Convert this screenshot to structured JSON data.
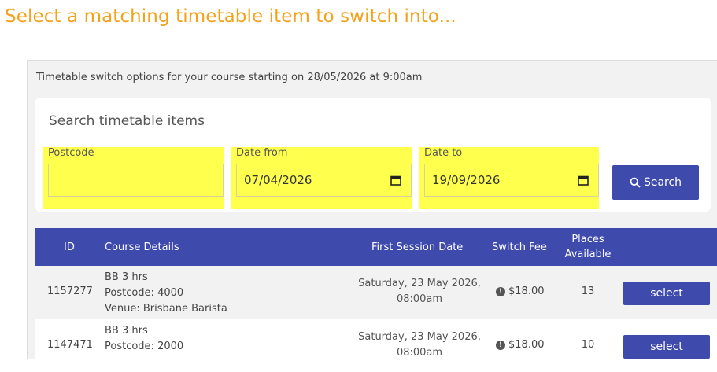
{
  "page": {
    "title": "Select a matching timetable item to switch into..."
  },
  "panel": {
    "intro": "Timetable switch options for your course starting on 28/05/2026 at 9:00am"
  },
  "search": {
    "title": "Search timetable items",
    "fields": {
      "postcode": {
        "label": "Postcode",
        "value": ""
      },
      "date_from": {
        "label": "Date from",
        "value": "07/04/2026"
      },
      "date_to": {
        "label": "Date to",
        "value": "19/09/2026"
      }
    },
    "button_label": "Search",
    "button_icon": "search-icon",
    "highlight_color": "#ffff4d"
  },
  "table": {
    "headers": {
      "id": "ID",
      "course_details": "Course Details",
      "first_session_date": "First Session Date",
      "switch_fee": "Switch Fee",
      "places_available_line1": "Places",
      "places_available_line2": "Available"
    },
    "rows": [
      {
        "id": "1157277",
        "name": "BB 3 hrs",
        "postcode": "Postcode: 4000",
        "venue": "Venue: Brisbane Barista",
        "date_line1": "Saturday, 23 May 2026,",
        "date_line2": "08:00am",
        "fee": "$18.00",
        "places": "13",
        "action": "select"
      },
      {
        "id": "1147471",
        "name": "BB 3 hrs",
        "postcode": "Postcode: 2000",
        "venue": "",
        "date_line1": "Saturday, 23 May 2026,",
        "date_line2": "08:00am",
        "fee": "$18.00",
        "places": "10",
        "action": "select"
      }
    ]
  },
  "colors": {
    "accent": "#f5a21b",
    "primary": "#3f4aad",
    "panel_bg": "#f2f2f2"
  }
}
